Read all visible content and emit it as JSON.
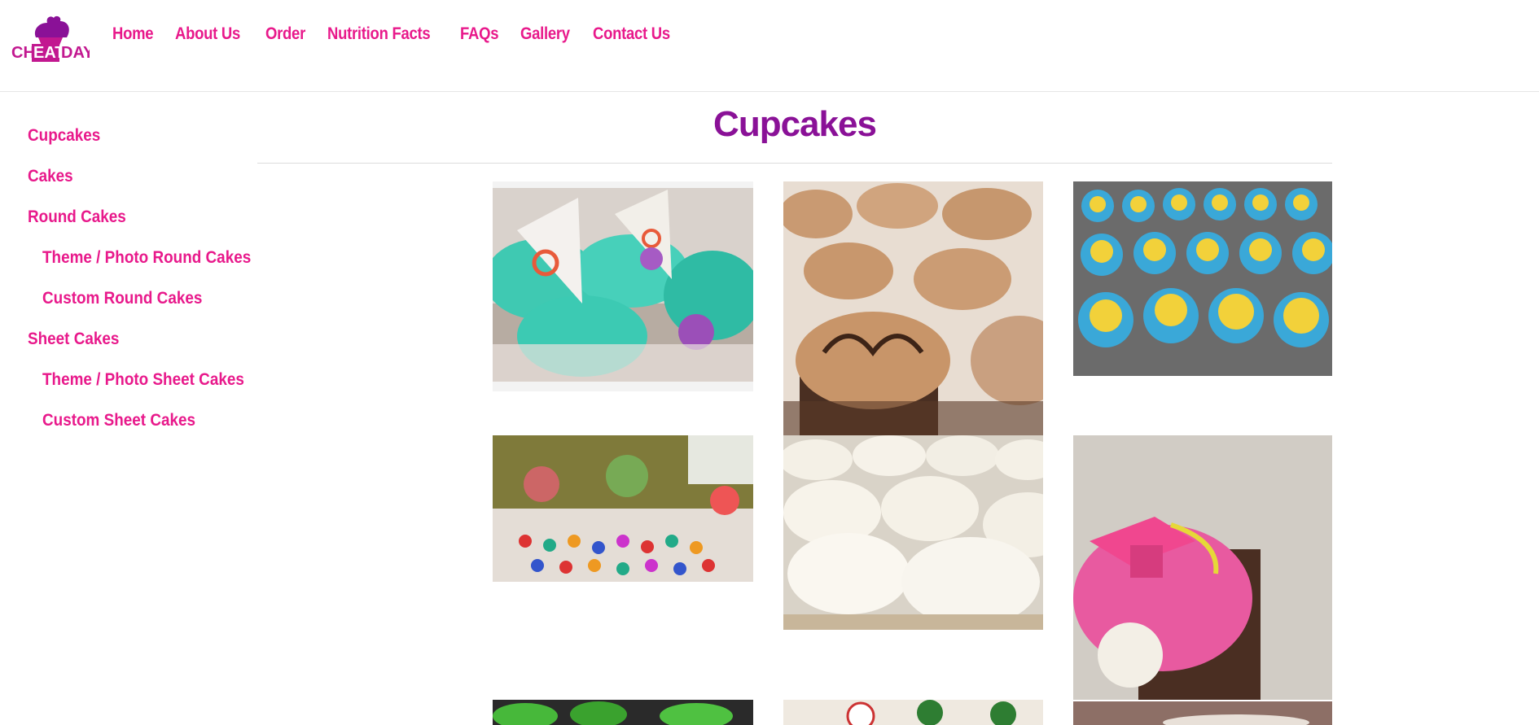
{
  "brand": {
    "logo_text_left": "CH",
    "logo_text_mid": "EAT",
    "logo_text_right": "DAY",
    "color_primary": "#e8198b",
    "color_title": "#8a1197"
  },
  "nav": [
    {
      "label": "Home"
    },
    {
      "label": "About Us"
    },
    {
      "label": "Order"
    },
    {
      "label": "Nutrition Facts"
    },
    {
      "label": "FAQs"
    },
    {
      "label": "Gallery"
    },
    {
      "label": "Contact Us"
    }
  ],
  "sidebar": [
    {
      "label": "Cupcakes"
    },
    {
      "label": "Cakes"
    },
    {
      "label": "Round Cakes"
    },
    {
      "label": "Theme / Photo Round Cakes"
    },
    {
      "label": "Custom Round Cakes"
    },
    {
      "label": "Sheet Cakes"
    },
    {
      "label": "Theme / Photo Sheet Cakes"
    },
    {
      "label": "Custom Sheet Cakes"
    }
  ],
  "page": {
    "title": "Cupcakes"
  },
  "gallery": [
    {
      "subject": "teal frosted cupcakes with purple flowers and swirl sails"
    },
    {
      "subject": "chocolate cupcakes with mocha frosting drizzle"
    },
    {
      "subject": "blue frosted emoji face cupcakes"
    },
    {
      "subject": "table of colorful mini cupcakes and pompom towers"
    },
    {
      "subject": "white buttercream cupcakes"
    },
    {
      "subject": "pink graduation cap cupcake"
    },
    {
      "subject": "green frosted cupcakes"
    },
    {
      "subject": "sports logo topper cupcakes"
    },
    {
      "subject": "brown cupcake photo"
    }
  ]
}
